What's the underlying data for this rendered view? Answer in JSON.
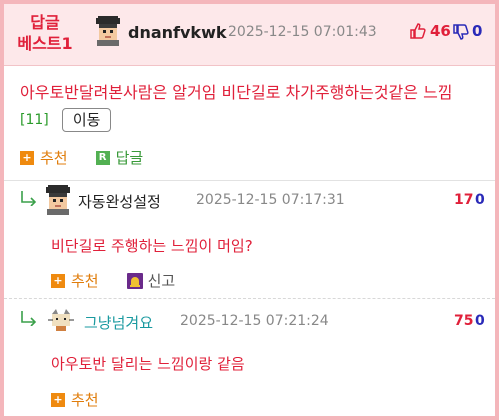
{
  "best": {
    "badge": "답글\n베스트1",
    "badge_line1": "답글",
    "badge_line2": "베스트1",
    "author": "dnanfvkwk",
    "time": "2025-12-15  07:01:43",
    "upvotes": "46",
    "downvotes": "0",
    "content": "아우토반달려본사람은 알거임 비단길로 차가주행하는것같은 느낌",
    "reply_count": "[11]",
    "move_button": "이동",
    "actions": {
      "recommend": "추천",
      "reply": "답글"
    }
  },
  "replies": [
    {
      "author": "자동완성설정",
      "time": "2025-12-15  07:17:31",
      "upvotes": "17",
      "downvotes": "0",
      "content": "비단길로 주행하는 느낌이 머임?",
      "recommend": "추천",
      "report": "신고"
    },
    {
      "author": "그냥넘겨요",
      "time": "2025-12-15  07:21:24",
      "upvotes": "75",
      "downvotes": "0",
      "content": "아우토반 달리는 느낌이랑 같음",
      "recommend": "추천"
    }
  ],
  "colors": {
    "accent_red": "#e0203a",
    "blue": "#2a2ab8",
    "header_bg": "#fde8ea",
    "border_pink": "#f4b6bb",
    "reply_author_teal": "#1a9aa0"
  }
}
